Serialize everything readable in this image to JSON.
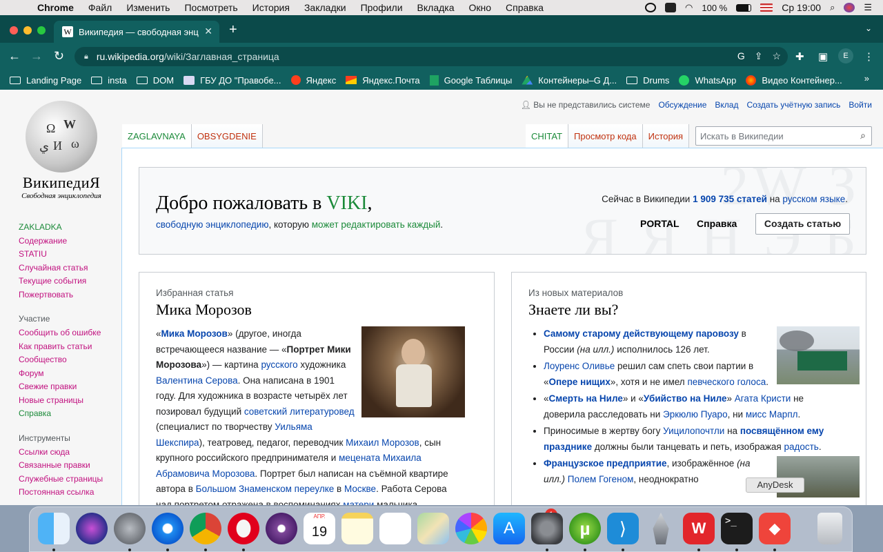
{
  "menubar": {
    "app": "Chrome",
    "items": [
      "Файл",
      "Изменить",
      "Посмотреть",
      "История",
      "Закладки",
      "Профили",
      "Вкладка",
      "Окно",
      "Справка"
    ],
    "battery": "100 %",
    "clock": "Ср 19:00"
  },
  "browser": {
    "tab_title": "Википедия — свободная энц",
    "tab_favicon": "W",
    "url_host": "ru.wikipedia.org",
    "url_path": "/wiki/Заглавная_страница",
    "profile_initial": "E"
  },
  "bookmarks": [
    {
      "label": "Landing Page",
      "icon": "folder-icon"
    },
    {
      "label": "insta",
      "icon": "folder-icon"
    },
    {
      "label": "DOM",
      "icon": "folder-icon"
    },
    {
      "label": "ГБУ ДО \"Правобе...",
      "icon": "emblem-icon"
    },
    {
      "label": "Яндекс",
      "icon": "yandex-icon"
    },
    {
      "label": "Яндекс.Почта",
      "icon": "mail-icon"
    },
    {
      "label": "Google Таблицы",
      "icon": "sheets-icon"
    },
    {
      "label": "Контейнеры–G Д...",
      "icon": "drive-icon"
    },
    {
      "label": "Drums",
      "icon": "folder-icon"
    },
    {
      "label": "WhatsApp",
      "icon": "whatsapp-icon"
    },
    {
      "label": "Видео Контейнер...",
      "icon": "video-icon"
    }
  ],
  "wiki": {
    "wordmark": "ВикипедиЯ",
    "tagline": "Свободная энциклопедия",
    "personal": {
      "anon": "Вы не представились системе",
      "talk": "Обсуждение",
      "contribs": "Вклад",
      "create_account": "Создать учётную запись",
      "login": "Войти"
    },
    "nav_main": [
      {
        "label": "ZAKLADKA",
        "style": "green"
      },
      {
        "label": "Содержание",
        "style": "pink"
      },
      {
        "label": "STATIU",
        "style": "pink"
      },
      {
        "label": "Случайная статья",
        "style": "pink"
      },
      {
        "label": "Текущие события",
        "style": "pink"
      },
      {
        "label": "Пожертвовать",
        "style": "pink"
      }
    ],
    "nav_participation_heading": "Участие",
    "nav_participation": [
      {
        "label": "Сообщить об ошибке",
        "style": "pink"
      },
      {
        "label": "Как править статьи",
        "style": "pink"
      },
      {
        "label": "Сообщество",
        "style": "pink"
      },
      {
        "label": "Форум",
        "style": "pink"
      },
      {
        "label": "Свежие правки",
        "style": "pink"
      },
      {
        "label": "Новые страницы",
        "style": "pink"
      },
      {
        "label": "Справка",
        "style": "green"
      }
    ],
    "nav_tools_heading": "Инструменты",
    "nav_tools": [
      {
        "label": "Ссылки сюда",
        "style": "pink"
      },
      {
        "label": "Связанные правки",
        "style": "pink"
      },
      {
        "label": "Служебные страницы",
        "style": "pink"
      },
      {
        "label": "Постоянная ссылка",
        "style": "pink"
      }
    ],
    "tabs_left": [
      "ZAGLAVNAYA",
      "OBSYGDENIE"
    ],
    "tabs_right": [
      "CHITAT",
      "Просмотр кода",
      "История"
    ],
    "search_placeholder": "Искать в Википедии",
    "welcome": {
      "title_a": "Добро пожаловать в ",
      "title_b": "VIKI",
      "title_c": ",",
      "sub_a": "свободную энциклопедию",
      "sub_b": ", которую ",
      "sub_c": "может редактировать каждый",
      "sub_d": ".",
      "count_a": "Сейчас в Википедии ",
      "count_n": "1 909 735 статей",
      "count_b": " на ",
      "count_c": "русском языке",
      "count_d": ".",
      "portal": "PORTAL",
      "help": "Справка",
      "create": "Создать статью",
      "bg": "2W З\nЯ Я Н Э Б"
    },
    "featured": {
      "label": "Избранная статья",
      "title": "Мика Морозов"
    },
    "dyk": {
      "label": "Из новых материалов",
      "title": "Знаете ли вы?"
    }
  },
  "tooltip": "AnyDesk",
  "dock": {
    "calendar_month": "АПР.",
    "calendar_day": "19",
    "appstore_badge": "1"
  }
}
